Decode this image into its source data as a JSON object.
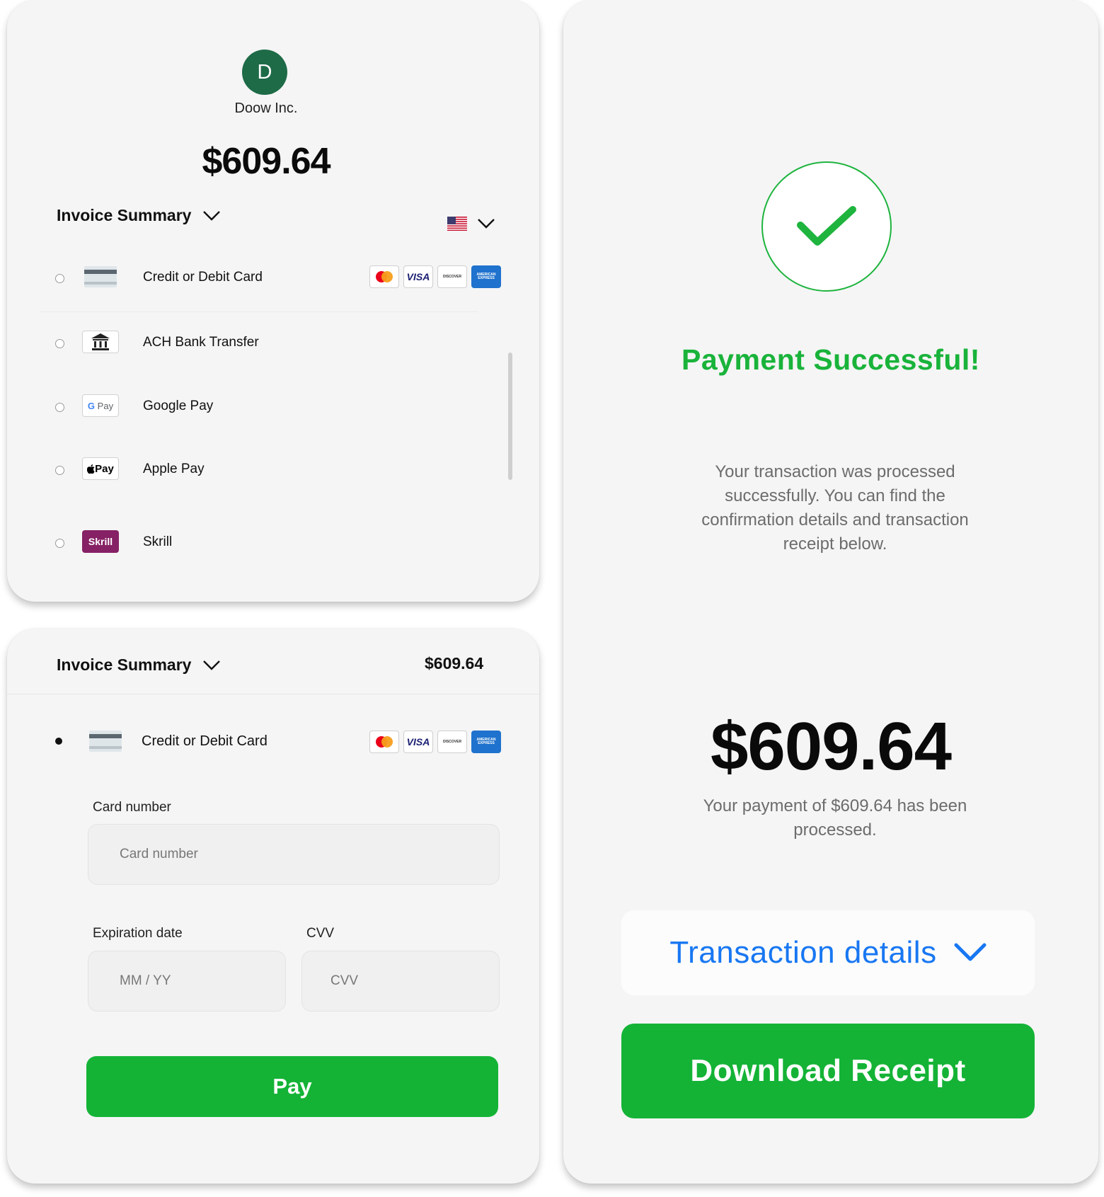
{
  "colors": {
    "accent_green": "#14b336",
    "avatar_green": "#1e6b47",
    "link_blue": "#1877f2",
    "card_bg": "#f5f5f5"
  },
  "checkout": {
    "avatar_letter": "D",
    "company": "Doow Inc.",
    "amount": "$609.64",
    "invoice_summary_label": "Invoice Summary",
    "locale_flag": "us-flag-icon",
    "payment_methods": [
      {
        "label": "Credit or Debit Card",
        "icon": "credit-card-icon"
      },
      {
        "label": "ACH Bank Transfer",
        "icon": "bank-icon"
      },
      {
        "label": "Google Pay",
        "icon": "google-pay-icon"
      },
      {
        "label": "Apple Pay",
        "icon": "apple-pay-icon"
      },
      {
        "label": "Skrill",
        "icon": "skrill-icon"
      }
    ],
    "card_brands": {
      "visa": "VISA",
      "discover": "DISCOVER",
      "amex": "AMERICAN EXPRESS"
    },
    "wallet_text": {
      "gpay_g": "G",
      "gpay_pay": "Pay",
      "apple_pay": "Pay",
      "skrill": "Skrill"
    }
  },
  "card_form": {
    "invoice_summary_label": "Invoice Summary",
    "amount": "$609.64",
    "selected_method": "Credit or Debit Card",
    "card_number_label": "Card number",
    "card_number_placeholder": "Card number",
    "expiration_label": "Expiration date",
    "expiration_placeholder": "MM / YY",
    "cvv_label": "CVV",
    "cvv_placeholder": "CVV",
    "pay_button": "Pay"
  },
  "success": {
    "title": "Payment Successful!",
    "description": "Your transaction was processed successfully. You can find the confirmation details and transaction receipt below.",
    "amount": "$609.64",
    "processed_text": "Your payment of $609.64 has been processed.",
    "transaction_details": "Transaction details",
    "download_button": "Download Receipt"
  }
}
